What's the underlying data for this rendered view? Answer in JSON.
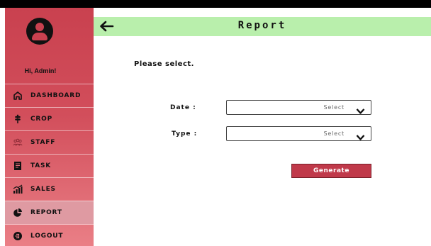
{
  "sidebar": {
    "greeting": "Hi, Admin!",
    "items": [
      {
        "label": "DASHBOARD",
        "icon": "home-icon"
      },
      {
        "label": "CROP",
        "icon": "crop-icon"
      },
      {
        "label": "STAFF",
        "icon": "staff-icon"
      },
      {
        "label": "TASK",
        "icon": "task-icon"
      },
      {
        "label": "SALES",
        "icon": "sales-icon"
      },
      {
        "label": "REPORT",
        "icon": "pie-chart-icon",
        "active": true
      },
      {
        "label": "LOGOUT",
        "icon": "logout-icon"
      }
    ]
  },
  "header": {
    "title": "Report"
  },
  "form": {
    "prompt": "Please select.",
    "date_label": "Date :",
    "date_value": "Select",
    "type_label": "Type :",
    "type_value": "Select",
    "generate_label": "Generate"
  },
  "colors": {
    "sidebar": "#c9414f",
    "header": "#b9efac",
    "button": "#c0394a",
    "active_item": "#df9aa2"
  }
}
